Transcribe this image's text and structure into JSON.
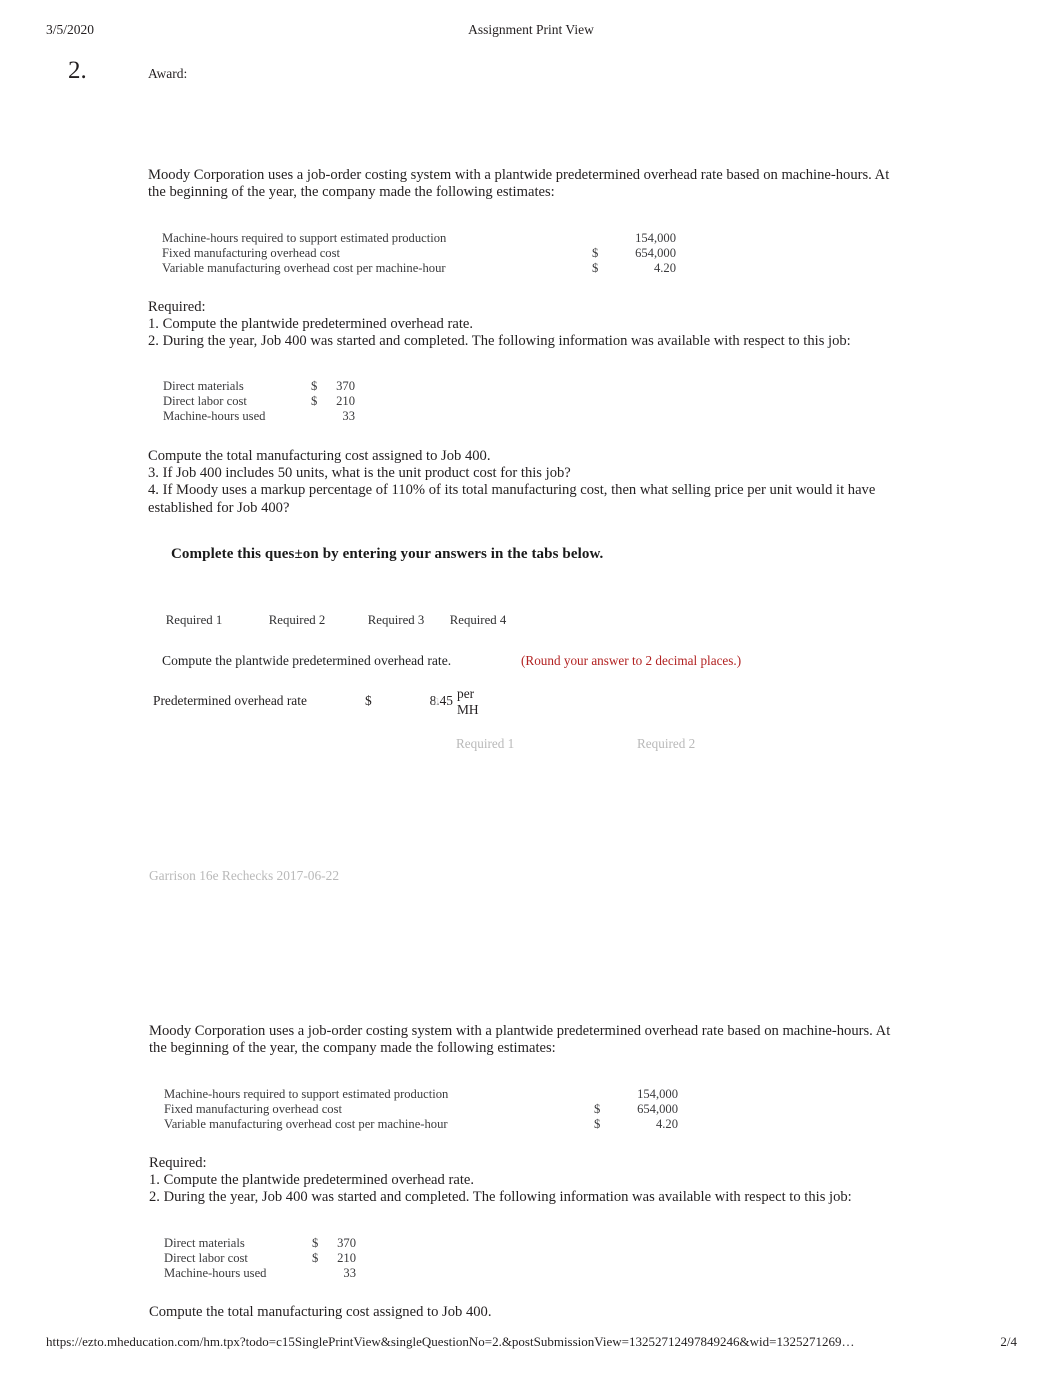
{
  "header": {
    "date": "3/5/2020",
    "title": "Assignment Print View"
  },
  "question": {
    "number": "2.",
    "award_label": "Award:"
  },
  "problem": {
    "intro": "Moody Corporation uses a job-order costing system with a plantwide predetermined overhead rate based on machine-hours. At the beginning of the year, the company made the following estimates:",
    "estimates_table": [
      {
        "label": "Machine-hours required to support estimated production",
        "currency": "",
        "value": "154,000"
      },
      {
        "label": "Fixed manufacturing overhead cost",
        "currency": "$",
        "value": "654,000"
      },
      {
        "label": "Variable manufacturing overhead cost per machine-hour",
        "currency": "$",
        "value": "4.20"
      }
    ],
    "required_heading": "Required:",
    "requirement_1": "1. Compute the plantwide predetermined overhead rate.",
    "requirement_2": "2. During the year, Job 400 was started and completed. The following information was available with respect to this job:",
    "job_table": [
      {
        "label": "Direct materials",
        "currency": "$",
        "value": "370"
      },
      {
        "label": "Direct labor cost",
        "currency": "$",
        "value": "210"
      },
      {
        "label": "Machine-hours used",
        "currency": "",
        "value": "33"
      }
    ],
    "compute_total": "Compute the total manufacturing cost assigned to Job 400.",
    "requirement_3": "3. If Job 400 includes 50 units, what is the unit product cost for this job?",
    "requirement_4": "4. If Moody uses a markup percentage of 110% of its total manufacturing cost, then what selling price per unit would it have established for Job 400?"
  },
  "answer_panel": {
    "complete_instruction": "Complete this ques±on by entering your answers in the tabs below.",
    "tabs": [
      {
        "label": "Required 1"
      },
      {
        "label": "Required 2"
      },
      {
        "label": "Required 3"
      },
      {
        "label": "Required 4"
      }
    ],
    "prompt": "Compute the plantwide predetermined overhead rate.",
    "round_hint": "(Round your answer to 2 decimal places.)",
    "round_hint_color": "#b22222",
    "answer": {
      "label": "Predetermined overhead rate",
      "currency": "$",
      "value": "8.45",
      "marker": "▯",
      "unit": "per MH"
    },
    "nav": {
      "prev_label": "Required 1",
      "next_label": "Required 2"
    }
  },
  "source_note": "Garrison 16e Rechecks 2017-06-22",
  "footer": {
    "url": "https://ezto.mheducation.com/hm.tpx?todo=c15SinglePrintView&singleQuestionNo=2.&postSubmissionView=13252712497849246&wid=1325271269…",
    "page": "2/4"
  }
}
